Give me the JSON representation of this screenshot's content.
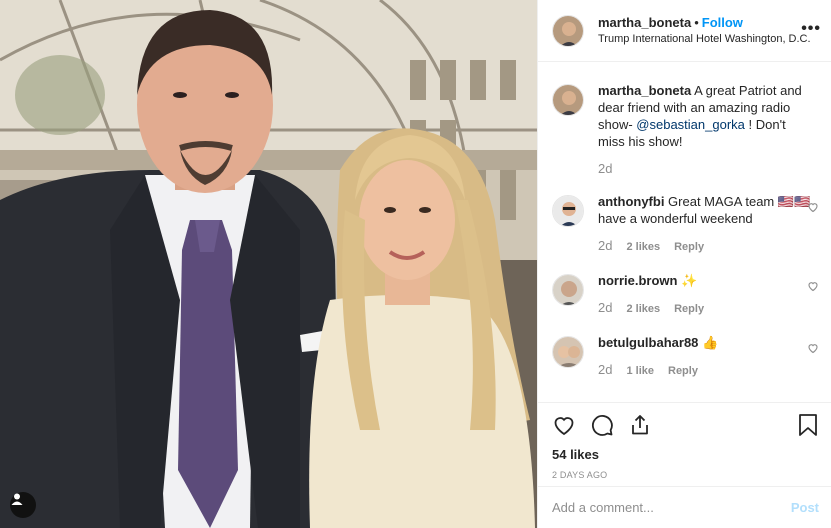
{
  "post": {
    "author": "martha_boneta",
    "separator": "•",
    "follow_label": "Follow",
    "location": "Trump International Hotel Washington, D.C.",
    "more_icon": "more-horizontal-icon"
  },
  "comments": [
    {
      "username": "martha_boneta",
      "text_before": " A great Patriot and dear friend with an amazing radio show- ",
      "mention": "@sebastian_gorka",
      "text_after": " ! Don't miss his show!",
      "age": "2d"
    },
    {
      "username": "anthonyfbi",
      "text": " Great MAGA team 🇺🇸🇺🇸 have a wonderful weekend",
      "age": "2d",
      "likes": "2 likes",
      "reply": "Reply"
    },
    {
      "username": "norrie.brown",
      "text": " ✨",
      "age": "2d",
      "likes": "2 likes",
      "reply": "Reply"
    },
    {
      "username": "betulgulbahar88",
      "text": " 👍",
      "age": "2d",
      "likes": "1 like",
      "reply": "Reply"
    }
  ],
  "actions": {
    "likes": "54 likes",
    "date": "2 DAYS AGO",
    "comment_placeholder": "Add a comment...",
    "post_label": "Post"
  },
  "colors": {
    "accent": "#0095f6",
    "mention": "#00376b",
    "muted": "#8e8e8e",
    "post_disabled": "#b2dffc"
  }
}
